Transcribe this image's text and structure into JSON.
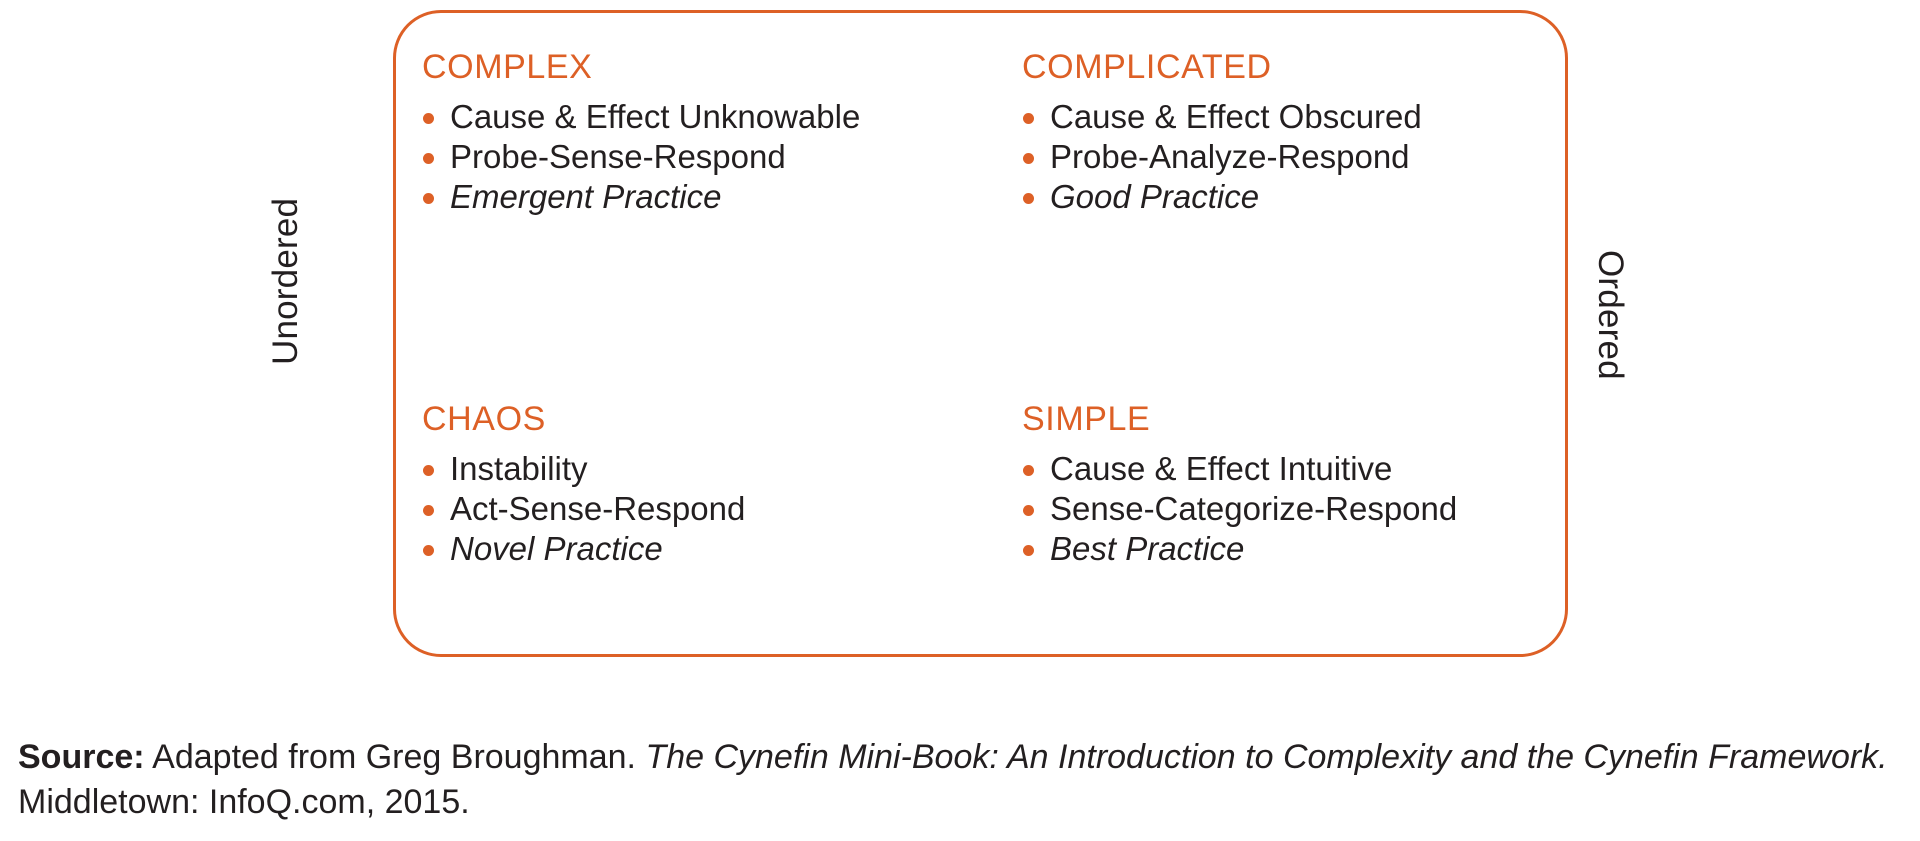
{
  "diagram": {
    "type": "cynefin-framework",
    "accent_color": "#DD6026",
    "text_color": "#231F20",
    "background_color": "#FFFFFF",
    "axis_labels": {
      "left": "Unordered",
      "right": "Ordered"
    },
    "quadrants": [
      {
        "id": "complex",
        "position": "top-left",
        "title": "COMPLEX",
        "bullets": [
          {
            "text": "Cause & Effect Unknowable",
            "italic": false
          },
          {
            "text": "Probe-Sense-Respond",
            "italic": false
          },
          {
            "text": "Emergent Practice",
            "italic": true
          }
        ]
      },
      {
        "id": "complicated",
        "position": "top-right",
        "title": "COMPLICATED",
        "bullets": [
          {
            "text": "Cause & Effect Obscured",
            "italic": false
          },
          {
            "text": "Probe-Analyze-Respond",
            "italic": false
          },
          {
            "text": "Good Practice",
            "italic": true
          }
        ]
      },
      {
        "id": "chaos",
        "position": "bottom-left",
        "title": "CHAOS",
        "bullets": [
          {
            "text": "Instability",
            "italic": false
          },
          {
            "text": "Act-Sense-Respond",
            "italic": false
          },
          {
            "text": "Novel Practice",
            "italic": true
          }
        ]
      },
      {
        "id": "simple",
        "position": "bottom-right",
        "title": "SIMPLE",
        "bullets": [
          {
            "text": "Cause & Effect Intuitive",
            "italic": false
          },
          {
            "text": "Sense-Categorize-Respond",
            "italic": false
          },
          {
            "text": "Best Practice",
            "italic": true
          }
        ]
      }
    ]
  },
  "source": {
    "label": "Source:",
    "attribution": " Adapted from Greg Broughman. ",
    "title": "The Cynefin Mini-Book: An Introduction to Complexity and the Cynefin Framework.",
    "publication": " Middletown: InfoQ.com, 2015."
  }
}
